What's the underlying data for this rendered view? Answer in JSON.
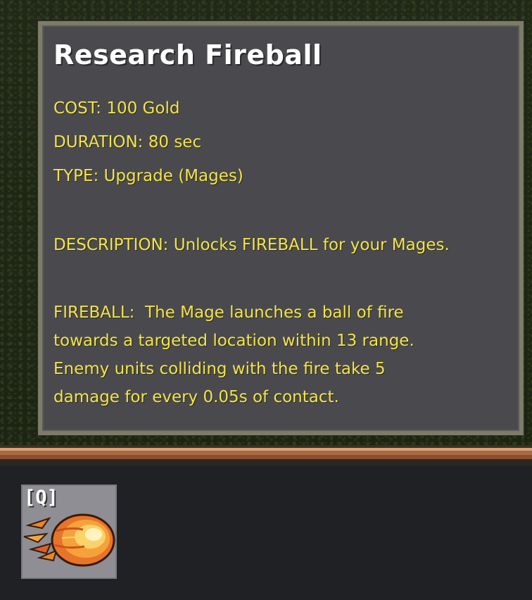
{
  "tooltip": {
    "title": "Research Fireball",
    "cost": "COST: 100 Gold",
    "duration": "DURATION: 80 sec",
    "type": "TYPE: Upgrade (Mages)",
    "description": "DESCRIPTION: Unlocks FIREBALL for your Mages.",
    "fireball_lines": [
      "FIREBALL:  The Mage launches a ball of fire",
      "towards a targeted location within 13 range.",
      "Enemy units colliding with the fire take 5",
      "damage for every 0.05s of contact."
    ]
  },
  "action_bar": {
    "slots": [
      {
        "hotkey": "[Q]",
        "icon": "fireball-icon"
      }
    ]
  },
  "colors": {
    "tooltip_bg": "#4a4a4e",
    "tooltip_border": "#7d7c6a",
    "title_text": "#ffffff",
    "body_text": "#f3e44a",
    "panel_bg": "#202124",
    "slot_bg": "#8e8e94"
  }
}
